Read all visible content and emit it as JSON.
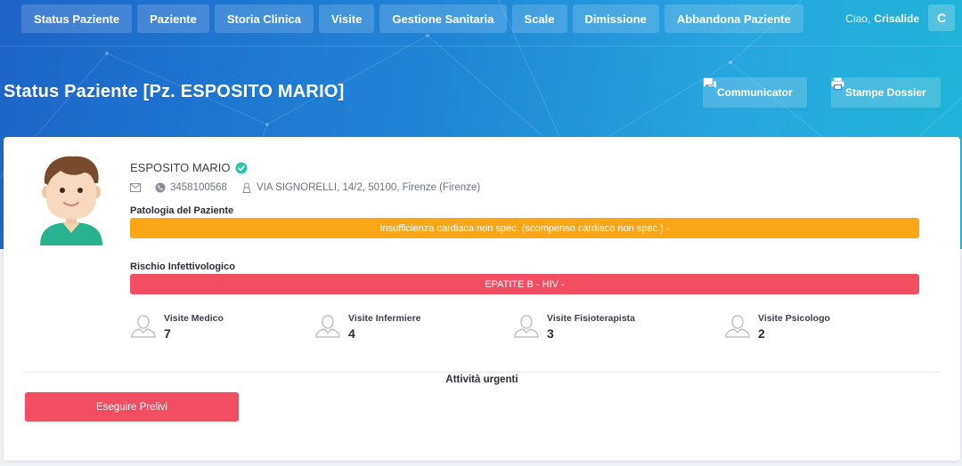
{
  "nav": {
    "items": [
      {
        "label": "Status Paziente"
      },
      {
        "label": "Paziente"
      },
      {
        "label": "Storia Clinica"
      },
      {
        "label": "Visite"
      },
      {
        "label": "Gestione Sanitaria"
      },
      {
        "label": "Scale"
      },
      {
        "label": "Dimissione"
      },
      {
        "label": "Abbandona Paziente"
      }
    ],
    "greeting": "Ciao,",
    "user_name": "Crisalide",
    "user_initial": "C"
  },
  "header": {
    "title": "Status Paziente [Pz. ESPOSITO MARIO]",
    "communicator_label": "Communicator",
    "stampe_label": "Stampe Dossier"
  },
  "patient": {
    "name": "ESPOSITO MARIO",
    "phone": "3458100568",
    "address": "VIA SIGNORELLI, 14/2, 50100, Firenze (Firenze)"
  },
  "pathology": {
    "label": "Patologia del Paziente",
    "value": "Insufficienza cardiaca non spec. (scompenso cardiaco non spec.) -"
  },
  "risk": {
    "label": "Rischio Infettivologico",
    "value": "EPATITE B - HIV -"
  },
  "stats": [
    {
      "label": "Visite Medico",
      "value": "7"
    },
    {
      "label": "Visite Infermiere",
      "value": "4"
    },
    {
      "label": "Visite Fisioterapista",
      "value": "3"
    },
    {
      "label": "Visite Psicologo",
      "value": "2"
    }
  ],
  "urgent": {
    "title": "Attività urgenti",
    "button_label": "Eseguire Prelivi"
  },
  "colors": {
    "pathology_bar": "#fba616",
    "risk_bar": "#f24e62",
    "verified_badge": "#2ec4a8"
  },
  "icons": [
    "verified-icon",
    "mail-icon",
    "phone-icon",
    "location-icon",
    "chat-icon",
    "printer-icon",
    "user-outline-icon"
  ]
}
